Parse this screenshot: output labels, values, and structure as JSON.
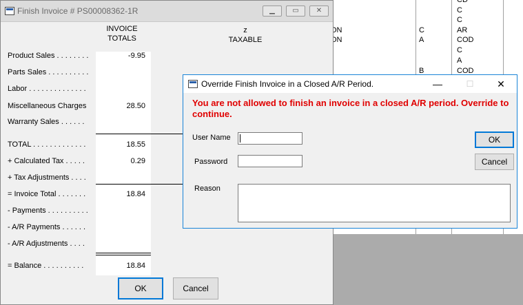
{
  "background_grid": {
    "rows": [
      {
        "c1": "",
        "c2": "",
        "c3": "CD"
      },
      {
        "c1": "",
        "c2": "",
        "c3": "C"
      },
      {
        "c1": "",
        "c2": "",
        "c3": "C"
      },
      {
        "c1": "ON",
        "c2": "C",
        "c3": "AR"
      },
      {
        "c1": "ON",
        "c2": "A",
        "c3": "COD"
      },
      {
        "c1": "",
        "c2": "",
        "c3": "C"
      },
      {
        "c1": "",
        "c2": "",
        "c3": "A"
      },
      {
        "c1": "",
        "c2": "B",
        "c3": "COD"
      }
    ]
  },
  "invoice_window": {
    "title": "Finish Invoice # PS00008362-1R",
    "col_totals": [
      "INVOICE",
      "TOTALS"
    ],
    "col_taxable": [
      "z",
      "TAXABLE"
    ],
    "lines": [
      {
        "label": "Product Sales . . . . . . . .",
        "value": "-9.95"
      },
      {
        "label": "Parts Sales . . . . . . . . . .",
        "value": ""
      },
      {
        "label": "Labor . . . . . . . . . . . . . .",
        "value": ""
      },
      {
        "label": "Miscellaneous Charges",
        "value": "28.50"
      },
      {
        "label": "Warranty Sales . . . . . .",
        "value": ""
      },
      {
        "label": "TOTAL . . . . . . . . . . . . .",
        "value": "18.55"
      },
      {
        "label": "+ Calculated Tax . . . . .",
        "value": "0.29"
      },
      {
        "label": "+ Tax Adjustments . . . .",
        "value": ""
      },
      {
        "label": "= Invoice Total . . . . . . .",
        "value": "18.84"
      },
      {
        "label": "- Payments . . . . . . . . . .",
        "value": ""
      },
      {
        "label": "- A/R Payments . . . . . .",
        "value": ""
      },
      {
        "label": "- A/R Adjustments . . . .",
        "value": ""
      },
      {
        "label": "= Balance . . . . . . . . . .",
        "value": "18.84"
      }
    ],
    "ok_label": "OK",
    "cancel_label": "Cancel"
  },
  "override_dialog": {
    "title": "Override Finish Invoice in a Closed A/R Period.",
    "message": "You are not allowed to finish an invoice in a closed A/R period. Override to continue.",
    "message_color": "#e00000",
    "username_label": "User Name",
    "username_value": "",
    "password_label": "Password",
    "password_value": "",
    "reason_label": "Reason",
    "reason_value": "",
    "ok_label": "OK",
    "cancel_label": "Cancel",
    "minimize_glyph": "—",
    "maximize_glyph": "☐",
    "close_glyph": "✕"
  }
}
